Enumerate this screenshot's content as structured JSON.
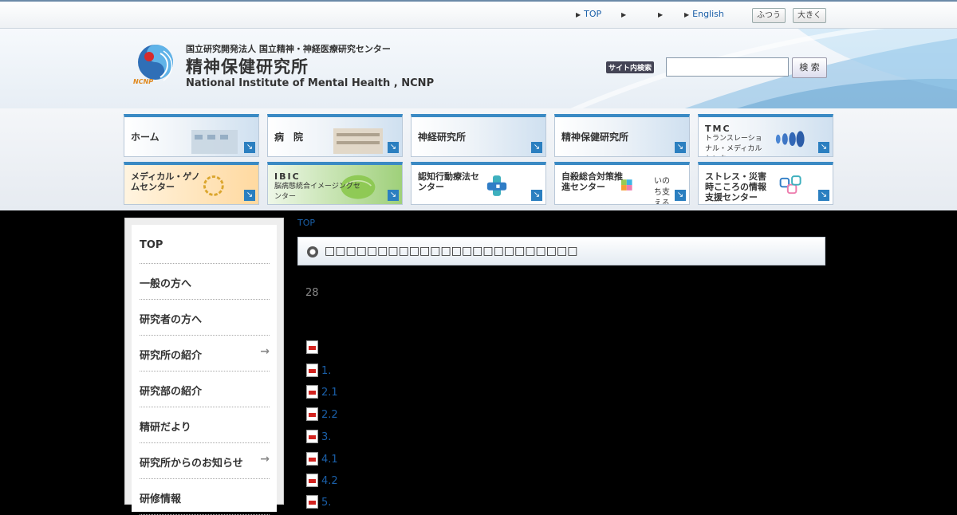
{
  "util": {
    "links": [
      {
        "label": "TOP"
      },
      {
        "label": ""
      },
      {
        "label": ""
      },
      {
        "label": "English"
      }
    ],
    "font_normal": "ふつう",
    "font_large": "大きく"
  },
  "header": {
    "org_sub": "国立研究開発法人 国立精神・神経医療研究センター",
    "org_name": "精神保健研究所",
    "org_en": "National Institute of Mental Health , NCNP",
    "logo_text": "NCNP",
    "search_label": "サイト内検索",
    "search_placeholder": "",
    "search_button": "検 索"
  },
  "nav": [
    {
      "label": "ホーム"
    },
    {
      "label": "病　院"
    },
    {
      "label": "神経研究所"
    },
    {
      "label": "精神保健研究所"
    },
    {
      "label": "TMC",
      "sub": "トランスレーショナル・メディカルセンター"
    },
    {
      "label": "メディカル・ゲノムセンター"
    },
    {
      "label": "IBIC",
      "sub": "脳病態統合イメージングセンター"
    },
    {
      "label": "認知行動療法センター"
    },
    {
      "label": "自殺総合対策推進センター",
      "extra": "いのち支える"
    },
    {
      "label": "ストレス・災害時こころの情報支援センター"
    }
  ],
  "sidebar": {
    "items": [
      {
        "label": "TOP",
        "arrow": ""
      },
      {
        "label": "一般の方へ",
        "arrow": ""
      },
      {
        "label": "研究者の方へ",
        "arrow": ""
      },
      {
        "label": "研究所の紹介",
        "arrow": "→"
      },
      {
        "label": "研究部の紹介",
        "arrow": ""
      },
      {
        "label": "精研だより",
        "arrow": ""
      },
      {
        "label": "研究所からのお知らせ",
        "arrow": "→"
      },
      {
        "label": "研修情報",
        "arrow": ""
      }
    ]
  },
  "main": {
    "breadcrumb": "TOP",
    "title": "□□□□□□□□□□□□□□□□□□□□□□□□",
    "number": "28",
    "pdf_items": [
      {
        "label": ""
      },
      {
        "label": "1."
      },
      {
        "label": "2.1"
      },
      {
        "label": "2.2"
      },
      {
        "label": "3."
      },
      {
        "label": "4.1"
      },
      {
        "label": "4.2"
      },
      {
        "label": "5."
      }
    ]
  },
  "colors": {
    "accent": "#2b7fc0",
    "link": "#1a5fa8",
    "background": "#000000"
  }
}
